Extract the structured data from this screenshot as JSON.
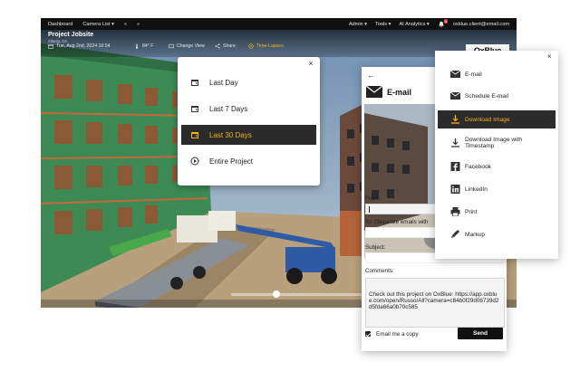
{
  "nav": {
    "left": [
      "Dashboard",
      "Camera List ▾",
      "«",
      "»"
    ],
    "right": [
      "Admin ▾",
      "Tools ▾",
      "AI Analytics ▾"
    ],
    "email": "oxblue.client@email.com",
    "badge": "8"
  },
  "project": {
    "title": "Project Jobsite",
    "location": "Atlanta, GA",
    "datetime": "Tue, Aug 2nd, 2024 10:54",
    "temperature": "84° F"
  },
  "controls": {
    "change_view": "Change View",
    "share": "Share",
    "timelapses": "Time-Lapses"
  },
  "logo": "OxBlue",
  "timelapse_menu": {
    "close": "×",
    "items": [
      {
        "label": "Last Day",
        "icon": "calendar-icon"
      },
      {
        "label": "Last 7 Days",
        "icon": "calendar-icon"
      },
      {
        "label": "Last 30 Days",
        "icon": "calendar-icon"
      },
      {
        "label": "Entire Project",
        "icon": "play-icon"
      }
    ],
    "selected": "Last 30 Days"
  },
  "email_panel": {
    "back": "←",
    "title": "E-mail",
    "from_label": "From:",
    "to_label": "To: (Separate emails with",
    "subject_label": "Subject:",
    "comments_label": "Comments:",
    "message": "Check out this project on OxBlue: https://app.oxblue.com/open/Russo/All?camera=c84b0f29d06739d2d5fda66a0b70c585",
    "checkbox_label": "Email me a copy",
    "checkbox_checked": true,
    "send_label": "Send"
  },
  "share_panel": {
    "close": "×",
    "items": [
      {
        "label": "E-mail",
        "icon": "envelope-icon"
      },
      {
        "label": "Schedule E-mail",
        "icon": "envelope-icon"
      },
      {
        "label": "Download Image",
        "icon": "download-icon"
      },
      {
        "label": "Download Image with",
        "label2": "Timestamp",
        "icon": "download-icon"
      },
      {
        "label": "Facebook",
        "icon": "facebook-icon"
      },
      {
        "label": "LinkedIn",
        "icon": "linkedin-icon"
      },
      {
        "label": "Print",
        "icon": "print-icon"
      },
      {
        "label": "Markup",
        "icon": "pencil-icon"
      }
    ],
    "selected": "Download Image"
  },
  "colors": {
    "accent": "#f2b21b",
    "nav_bg": "#101010",
    "selected_bg": "#2b2b2b"
  }
}
